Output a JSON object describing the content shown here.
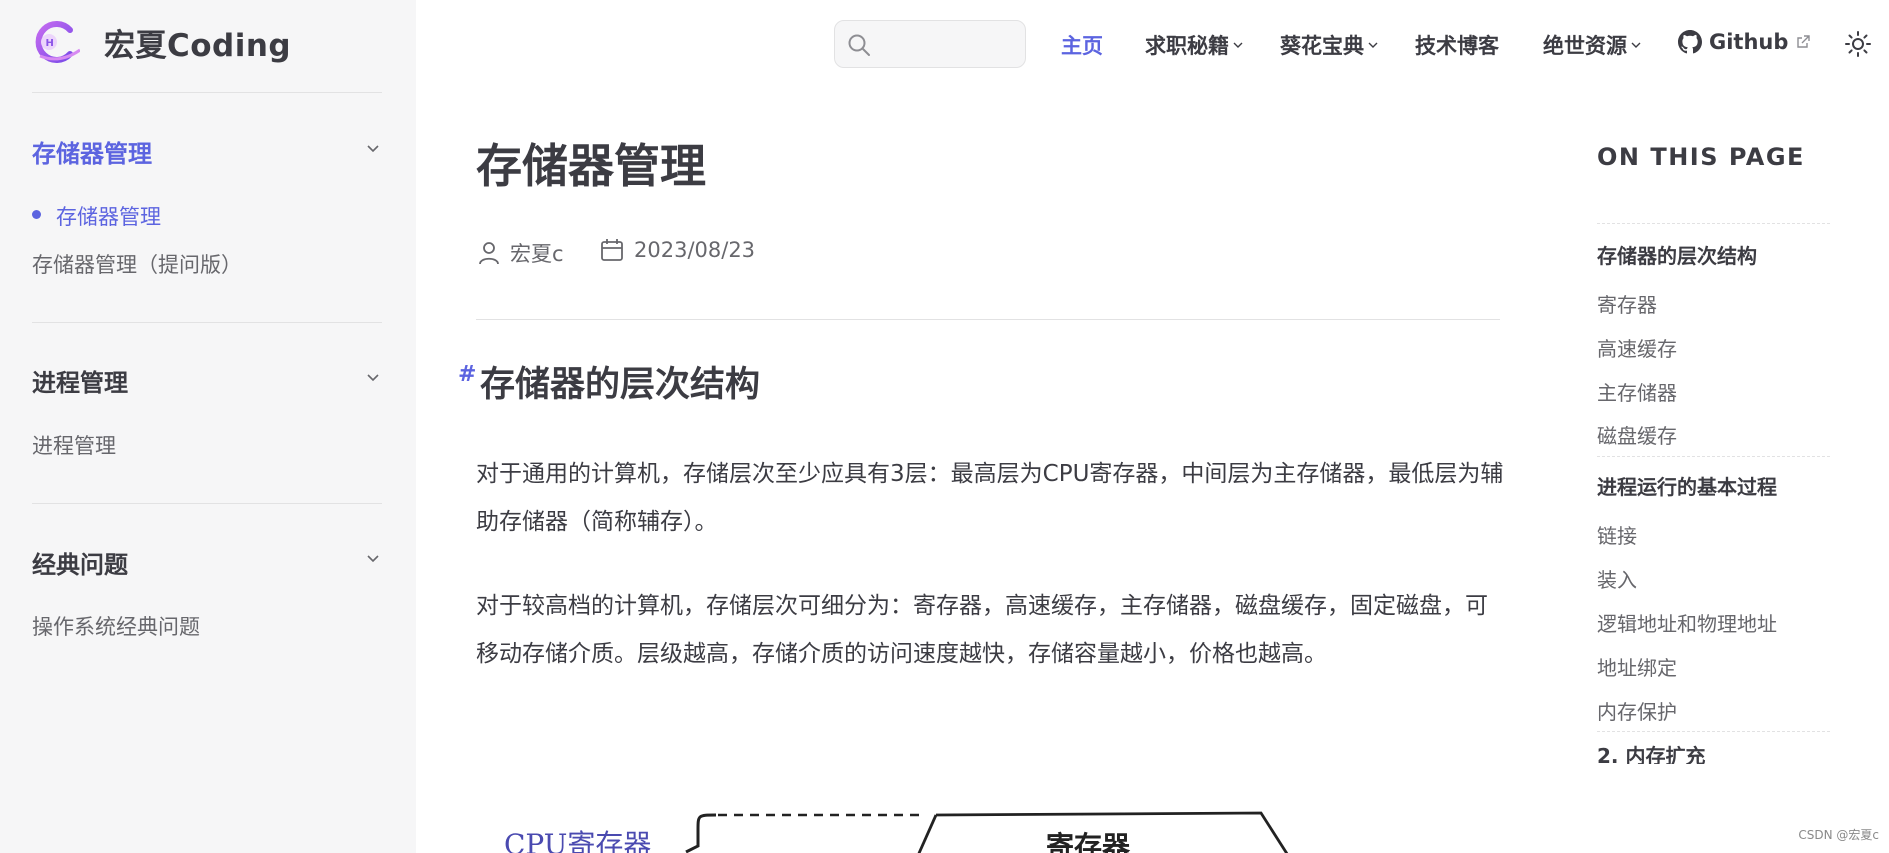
{
  "site": {
    "title": "宏夏Coding"
  },
  "sidebar": {
    "groups": [
      {
        "title": "存储器管理",
        "items": [
          "存储器管理",
          "存储器管理（提问版）"
        ]
      },
      {
        "title": "进程管理",
        "items": [
          "进程管理"
        ]
      },
      {
        "title": "经典问题",
        "items": [
          "操作系统经典问题"
        ]
      }
    ]
  },
  "search": {
    "placeholder": ""
  },
  "nav": {
    "home": "主页",
    "job": "求职秘籍",
    "kuihua": "葵花宝典",
    "blog": "技术博客",
    "resources": "绝世资源",
    "github": "Github"
  },
  "article": {
    "title": "存储器管理",
    "author": "宏夏c",
    "date": "2023/08/23",
    "h2_hash": "#",
    "h2": "存储器的层次结构",
    "p1": "对于通用的计算机，存储层次至少应具有3层：最高层为CPU寄存器，中间层为主存储器，最低层为辅助存储器（简称辅存）。",
    "p2": "对于较高档的计算机，存储层次可细分为：寄存器，高速缓存，主存储器，磁盘缓存，固定磁盘，可移动存储介质。层级越高，存储介质的访问速度越快，存储容量越小，价格也越高。",
    "figure": {
      "left_label": "CPU寄存器",
      "box_label": "寄存器"
    }
  },
  "toc": {
    "title": "ON THIS PAGE",
    "items": [
      "存储器的层次结构",
      "寄存器",
      "高速缓存",
      "主存储器",
      "磁盘缓存",
      "进程运行的基本过程",
      "链接",
      "装入",
      "逻辑地址和物理地址",
      "地址绑定",
      "内存保护",
      "2. 内存扩充"
    ]
  },
  "watermark": "CSDN @宏夏c",
  "colors": {
    "accent": "#5c64e0",
    "text": "#3c3c43",
    "muted": "#67676c",
    "sidebar_bg": "#f6f6f7"
  }
}
